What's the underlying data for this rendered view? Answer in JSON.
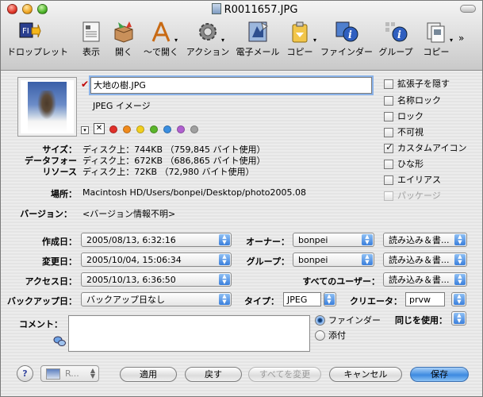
{
  "window": {
    "title": "R0011657.JPG"
  },
  "toolbar": {
    "items": [
      {
        "label": "ドロップレット",
        "icon": "droplet-icon"
      },
      {
        "label": "表示",
        "icon": "view-icon"
      },
      {
        "label": "開く",
        "icon": "open-box-icon"
      },
      {
        "label": "〜で開く",
        "icon": "open-with-icon"
      },
      {
        "label": "アクション",
        "icon": "action-gear-icon"
      },
      {
        "label": "電子メール",
        "icon": "email-icon"
      },
      {
        "label": "コピー",
        "icon": "copy-clipboard-icon"
      },
      {
        "label": "ファインダー",
        "icon": "finder-info-icon"
      },
      {
        "label": "グループ",
        "icon": "group-info-icon"
      },
      {
        "label": "コピー",
        "icon": "copy-doc-icon"
      }
    ],
    "overflow": "»"
  },
  "file": {
    "name": "大地の樹.JPG",
    "kind": "JPEG イメージ",
    "label_none": "✕",
    "label_colors": [
      "#e0302a",
      "#f08a1c",
      "#f2cf1f",
      "#5ab52a",
      "#3a8ee0",
      "#b060d0",
      "#a0a0a0"
    ]
  },
  "sizes": {
    "labels": [
      "サイズ：",
      "データフォー",
      "リソース"
    ],
    "values": [
      "ディスク上：744KB （759,845 バイト使用）",
      "ディスク上：672KB （686,865 バイト使用）",
      "ディスク上：72KB （72,980 バイト使用）"
    ]
  },
  "location": {
    "label": "場所：",
    "value": "Macintosh HD/Users/bonpei/Desktop/photo2005.08"
  },
  "version": {
    "label": "バージョン：",
    "value": "<バージョン情報不明>"
  },
  "flags": [
    {
      "label": "拡張子を隠す",
      "checked": false,
      "disabled": false
    },
    {
      "label": "名称ロック",
      "checked": false,
      "disabled": false
    },
    {
      "label": "ロック",
      "checked": false,
      "disabled": false
    },
    {
      "label": "不可視",
      "checked": false,
      "disabled": false
    },
    {
      "label": "カスタムアイコン",
      "checked": true,
      "disabled": false
    },
    {
      "label": "ひな形",
      "checked": false,
      "disabled": false
    },
    {
      "label": "エイリアス",
      "checked": false,
      "disabled": false
    },
    {
      "label": "パッケージ",
      "checked": false,
      "disabled": true
    }
  ],
  "dates": {
    "created_label": "作成日：",
    "created": "2005/08/13, 6:32:16",
    "modified_label": "変更日：",
    "modified": "2005/10/04, 15:06:34",
    "accessed_label": "アクセス日：",
    "accessed": "2005/10/13, 6:36:50",
    "backup_label": "バックアップ日：",
    "backup": "バックアップ日なし"
  },
  "perms": {
    "owner_label": "オーナー：",
    "owner": "bonpei",
    "owner_access": "読み込み＆書...",
    "group_label": "グループ：",
    "group": "bonpei",
    "group_access": "読み込み＆書...",
    "everyone_label": "すべてのユーザー：",
    "everyone_access": "読み込み＆書..."
  },
  "codes": {
    "type_label": "タイプ：",
    "type": "JPEG",
    "creator_label": "クリエータ：",
    "creator": "prvw"
  },
  "comment": {
    "label": "コメント：",
    "value": ""
  },
  "open_with": {
    "options": [
      {
        "label": "ファインダー",
        "selected": true
      },
      {
        "label": "添付",
        "selected": false
      }
    ],
    "same_label": "同じを使用："
  },
  "footer": {
    "help": "?",
    "recent": "R...",
    "apply": "適用",
    "revert": "戻す",
    "apply_all": "すべてを変更",
    "cancel": "キャンセル",
    "save": "保存"
  }
}
